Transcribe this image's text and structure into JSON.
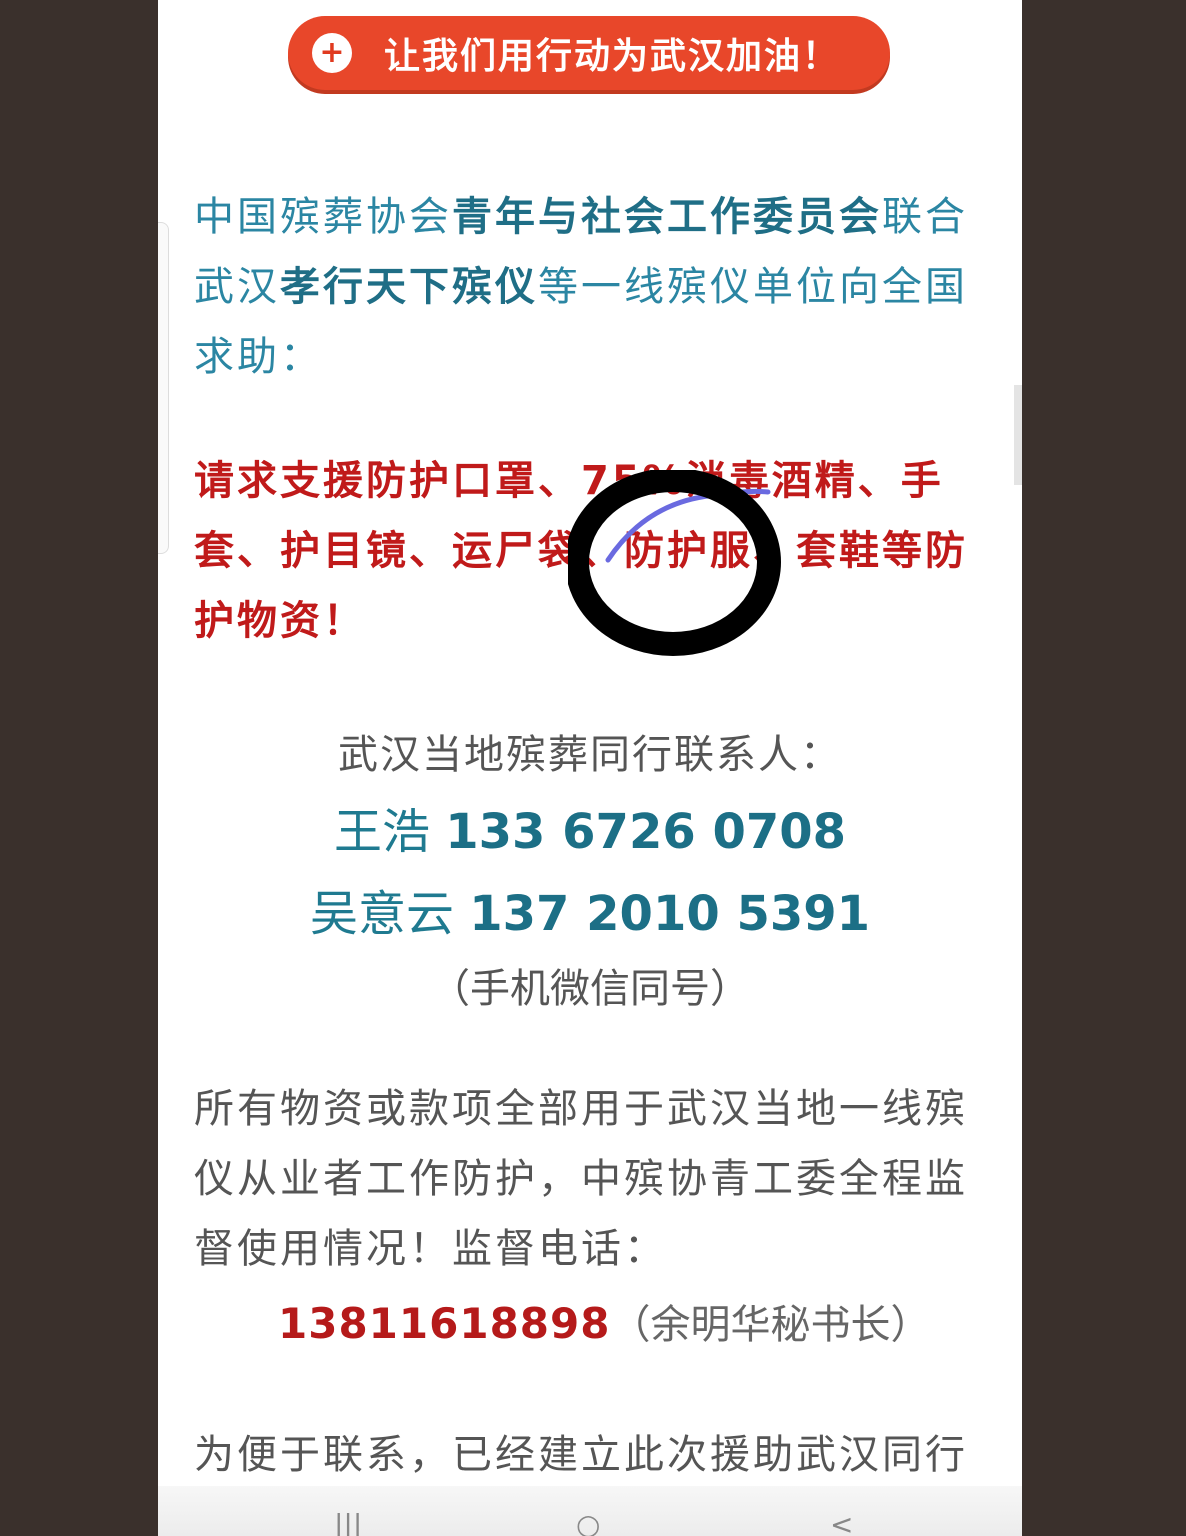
{
  "banner": {
    "text": "让我们用行动为武汉加油！",
    "icon": "red-cross-icon"
  },
  "intro": {
    "p1": "中国殡葬协会",
    "p2": "青年与社会工作委员会",
    "p3": "联合",
    "p4": "武汉",
    "p5": "孝行天下殡仪",
    "p6": "等一线殡仪单位向全国求助："
  },
  "request": {
    "text": "请求支援防护口罩、75%消毒酒精、手套、护目镜、运尸袋、防护服、套鞋等防护物资！"
  },
  "contacts": {
    "title": "武汉当地殡葬同行联系人：",
    "people": [
      {
        "name": "王浩",
        "phone": "133 6726 0708"
      },
      {
        "name": "吴意云",
        "phone": "137 2010 5391"
      }
    ],
    "note": "（手机微信同号）"
  },
  "supervision": {
    "text": "所有物资或款项全部用于武汉当地一线殡仪从业者工作防护，中殡协青工委全程监督使用情况！监督电话：",
    "phone": "13811618898",
    "person": "（余明华秘书长）"
  },
  "footer": {
    "text": "为便于联系，已经建立此次援助武汉同行"
  },
  "navbar": {
    "recent": "|||",
    "home": "○",
    "back": "<"
  },
  "colors": {
    "banner": "#e8472a",
    "teal": "#2b86a3",
    "red": "#c01a1a"
  }
}
